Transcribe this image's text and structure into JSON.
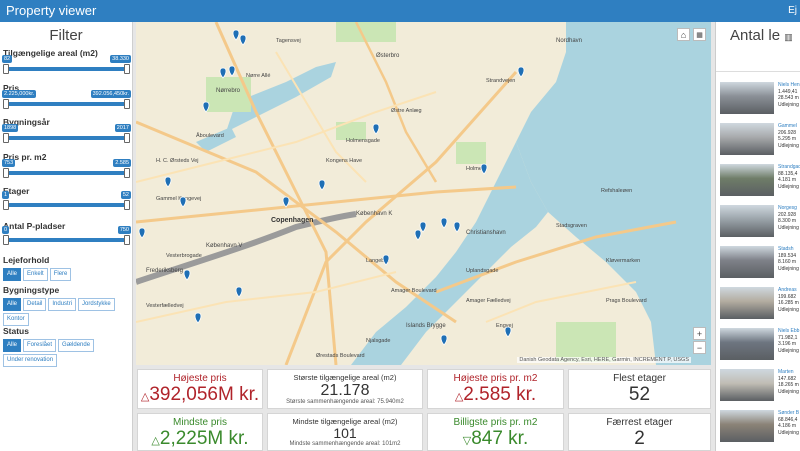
{
  "app": {
    "title": "Property viewer",
    "header_right": "Ej"
  },
  "filter": {
    "title": "Filter",
    "sliders": [
      {
        "label": "Tilgængelige areal (m2)",
        "min": "82",
        "max": "38.330"
      },
      {
        "label": "Pris",
        "min": "2.225,000kr.",
        "max": "392.056,450kr."
      },
      {
        "label": "Bygningsår",
        "min": "1898",
        "max": "2017"
      },
      {
        "label": "Pris pr. m2",
        "min": "753",
        "max": "2.585"
      },
      {
        "label": "Etager",
        "min": "1",
        "max": "52"
      },
      {
        "label": "Antal P-pladser",
        "min": "0",
        "max": "750"
      }
    ],
    "groups": [
      {
        "label": "Lejeforhold",
        "options": [
          "Alle",
          "Enkelt",
          "Flere"
        ]
      },
      {
        "label": "Bygningstype",
        "options": [
          "Alle",
          "Detail",
          "Industri",
          "Jordstykke",
          "Kontor"
        ]
      },
      {
        "label": "Status",
        "options": [
          "Alle",
          "Foreslået",
          "Gældende",
          "Under renovation"
        ]
      }
    ]
  },
  "map": {
    "labels": [
      "Copenhagen",
      "København K",
      "København V",
      "Nørrebro",
      "Østerbro",
      "Christianshavn",
      "Islands Brygge",
      "Frederiksberg",
      "Nordhavn",
      "Amager Boulevard",
      "Njalsgade",
      "Vesterbrogade",
      "Holmen",
      "Kløvermarken",
      "Refshaleøen",
      "Gammel Kongevej",
      "H. C. Ørsteds Vej",
      "Åboulevard",
      "Nørre Allé",
      "Tagensvej",
      "Vesterfælledvej",
      "Østre Anlæg",
      "Amager Fælledvej",
      "Stadsgraven",
      "Prags Boulevard",
      "Ørestads Boulevard",
      "Holmensgade",
      "Engvej",
      "Uplandsgade",
      "Strandvejen",
      "Langebro",
      "Kongens Have"
    ],
    "attribution": "Danish Geodata Agency, Esri, HERE, Garmin, INCREMENT P, USGS",
    "zoom_in": "+",
    "zoom_out": "−",
    "home_icon": "home-icon",
    "basemap_icon": "basemap-icon"
  },
  "stats": {
    "max_price_label": "Højeste pris",
    "max_price_value": "392,056M kr.",
    "min_price_label": "Mindste pris",
    "min_price_value": "2,225M kr.",
    "max_area_label": "Største tilgængelige areal (m2)",
    "max_area_value": "21.178",
    "max_area_sub": "Største sammenhængende areal: 75.940m2",
    "min_area_label": "Mindste tilgængelige areal (m2)",
    "min_area_value": "101",
    "min_area_sub": "Mindste sammenhængende areal: 101m2",
    "max_ppm_label": "Højeste pris pr. m2",
    "max_ppm_value": "2.585 kr.",
    "min_ppm_label": "Billigste pris pr. m2",
    "min_ppm_value": "847 kr.",
    "most_floors_label": "Flest etager",
    "most_floors_value": "52",
    "fewest_floors_label": "Færrest etager",
    "fewest_floors_value": "2"
  },
  "list": {
    "title": "Antal le",
    "items": [
      {
        "name": "Niels Hen",
        "l1": "1.449,41",
        "l2": "28.543 m",
        "l3": "Udlejning"
      },
      {
        "name": "Gammel",
        "l1": "206.928",
        "l2": "5.295 m",
        "l3": "Udlejning"
      },
      {
        "name": "Strandgade",
        "l1": "88.135,4",
        "l2": "4.181 m",
        "l3": "Udlejning"
      },
      {
        "name": "Norgesg",
        "l1": "202.928",
        "l2": "8.300 m",
        "l3": "Udlejning"
      },
      {
        "name": "Stadsh",
        "l1": "189.534",
        "l2": "8.160 m",
        "l3": "Udlejning"
      },
      {
        "name": "Andreas",
        "l1": "199.682",
        "l2": "16.285 m",
        "l3": "Udlejning"
      },
      {
        "name": "Niels Ebb",
        "l1": "71.982,1",
        "l2": "3.196 m",
        "l3": "Udlejning"
      },
      {
        "name": "Marten",
        "l1": "147.682",
        "l2": "18.265 m",
        "l3": "Udlejning"
      },
      {
        "name": "Sønder B",
        "l1": "68.846,4",
        "l2": "4.186 m",
        "l3": "Udlejning"
      }
    ]
  },
  "colors": {
    "header": "#2f7fc1",
    "accent": "#2f7fc1",
    "negative": "#b0232a",
    "positive": "#3a8a2c",
    "water": "#aad3df",
    "road": "#f4c98a"
  }
}
